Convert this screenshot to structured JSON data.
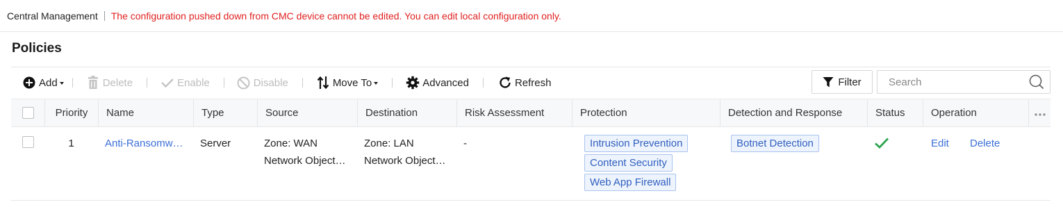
{
  "topbar": {
    "title": "Central Management",
    "warning": "The configuration pushed down from CMC device cannot be edited. You can edit local configuration only."
  },
  "page": {
    "heading": "Policies"
  },
  "toolbar": {
    "add": "Add",
    "delete": "Delete",
    "enable": "Enable",
    "disable": "Disable",
    "move_to": "Move To",
    "advanced": "Advanced",
    "refresh": "Refresh",
    "filter": "Filter",
    "search_placeholder": "Search"
  },
  "table": {
    "columns": [
      "Priority",
      "Name",
      "Type",
      "Source",
      "Destination",
      "Risk Assessment",
      "Protection",
      "Detection and Response",
      "Status",
      "Operation"
    ],
    "rows": [
      {
        "priority": "1",
        "name": "Anti-Ransomw…",
        "type": "Server",
        "source_line1": "Zone: WAN",
        "source_line2": "Network Object…",
        "destination_line1": "Zone: LAN",
        "destination_line2": "Network Object…",
        "risk": "-",
        "protection": [
          "Intrusion Prevention",
          "Content Security",
          "Web App Firewall"
        ],
        "detection": [
          "Botnet Detection"
        ],
        "status": "enabled",
        "operations": [
          "Edit",
          "Delete"
        ]
      }
    ]
  },
  "colors": {
    "warning": "#e02020",
    "link": "#3a6fd8",
    "status_ok": "#2ea44f",
    "tag_bg": "#eef4fd",
    "tag_border": "#a9c2ee"
  },
  "icons": [
    "plus-circle-icon",
    "trash-icon",
    "check-icon",
    "ban-icon",
    "move-icon",
    "gear-icon",
    "refresh-icon",
    "filter-icon",
    "search-icon",
    "more-icon",
    "status-check-icon"
  ]
}
